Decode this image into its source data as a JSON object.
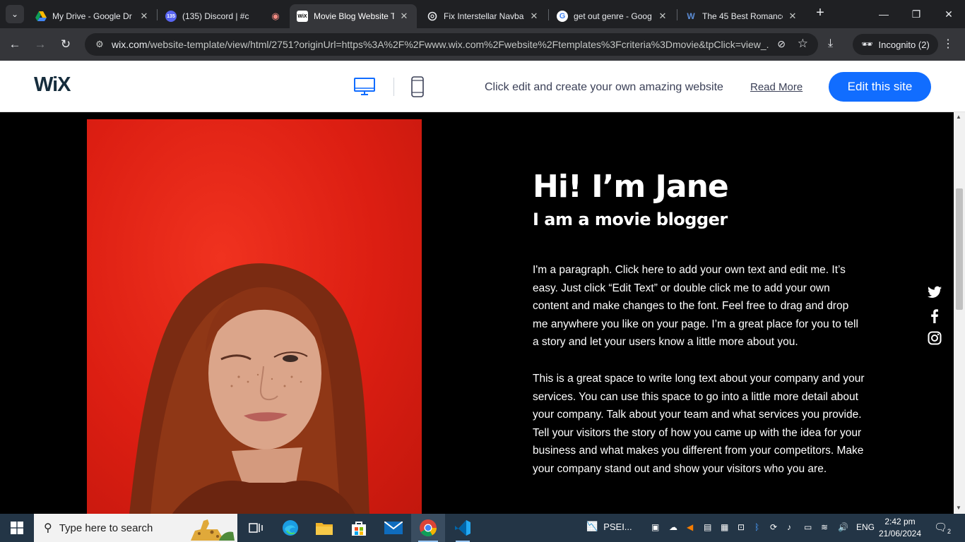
{
  "browser": {
    "tabs": [
      {
        "title": "My Drive - Google Dr",
        "favicon": "google-drive-icon"
      },
      {
        "title": "(135) Discord | #c",
        "favicon": "discord-icon",
        "badge": "135"
      },
      {
        "title": "Movie Blog Website T",
        "favicon": "wix-icon",
        "active": true
      },
      {
        "title": "Fix Interstellar Navba",
        "favicon": "chatgpt-icon"
      },
      {
        "title": "get out genre - Goog",
        "favicon": "google-icon"
      },
      {
        "title": "The 45 Best Romance",
        "favicon": "w-icon"
      }
    ],
    "address": {
      "host": "wix.com",
      "path": "/website-template/view/html/2751?originUrl=https%3A%2F%2Fwww.wix.com%2Fwebsite%2Ftemplates%3Fcriteria%3Dmovie&tpClick=view_..."
    },
    "profile_label": "Incognito (2)"
  },
  "wix_header": {
    "logo": "WiX",
    "message": "Click edit and create your own amazing website",
    "read_more": "Read More",
    "edit_button": "Edit this site"
  },
  "site": {
    "title": "Hi! I’m Jane",
    "subtitle": "I am a movie blogger",
    "paragraph1": "I'm a paragraph. Click here to add your own text and edit me. It’s easy. Just click “Edit Text” or double click me to add your own content and make changes to the font. Feel free to drag and drop me anywhere you like on your page. I’m a great place for you to tell a story and let your users know a little more about you.",
    "paragraph2": "This is a great space to write long text about your company and your services. You can use this space to go into a little more detail about your company. Talk about your team and what services you provide. Tell your visitors the story of how you came up with the idea for your business and what makes you different from your competitors. Make your company stand out and show your visitors who you are.",
    "social": [
      "twitter-icon",
      "facebook-icon",
      "instagram-icon"
    ]
  },
  "taskbar": {
    "search_placeholder": "Type here to search",
    "psei_label": "PSEI...",
    "language": "ENG",
    "time": "2:42 pm",
    "date": "21/06/2024",
    "notifications": "2"
  },
  "colors": {
    "wix_blue": "#116dff",
    "photo_red": "#e0241a",
    "taskbar": "#233546"
  }
}
